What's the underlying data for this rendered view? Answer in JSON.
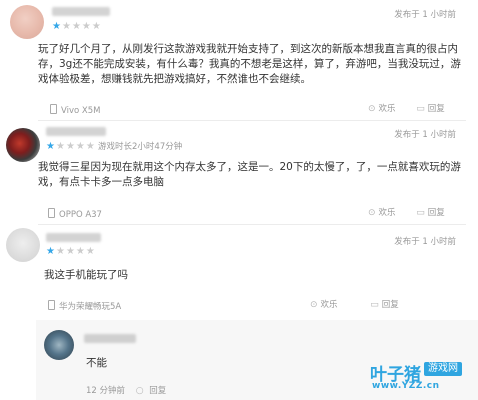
{
  "comments": [
    {
      "rating": 1,
      "posted": "发布于 1 小时前",
      "body": "玩了好几个月了，从刚发行这款游戏我就开始支持了，到这次的新版本想我直言真的很占内存，3g还不能完成安装，有什么毒？我真的不想老是这样，算了，弃游吧，当我没玩过，游戏体验极差，想赚钱就先把游戏搞好，不然谁也不会继续。",
      "device": "Vivo X5M",
      "actions": {
        "like": "欢乐",
        "reply": "回复"
      }
    },
    {
      "rating": 1,
      "playtime": "游戏时长2小时47分钟",
      "posted": "发布于 1 小时前",
      "body": "我觉得三星因为现在就用这个内存太多了，这是一。20下的太慢了，了，一点就喜欢玩的游戏，有点卡卡多一点多电脑",
      "device": "OPPO A37",
      "actions": {
        "like": "欢乐",
        "reply": "回复"
      }
    },
    {
      "rating": 1,
      "posted": "发布于 1 小时前",
      "body": "我这手机能玩了吗",
      "device": "华为荣耀畅玩5A",
      "actions": {
        "like": "欢乐",
        "reply": "回复"
      }
    }
  ],
  "reply": {
    "body": "不能",
    "posted": "12 分钟前",
    "action": "回复"
  },
  "watermark": {
    "brand": "叶子猪",
    "badge": "游戏网",
    "url": "www.YZZ.cn"
  },
  "colors": {
    "accent": "#35a7e8",
    "watermark": "#2fa5e0"
  },
  "icons": [
    "star-icon",
    "phone-icon",
    "comment-icon",
    "like-icon",
    "reply-icon"
  ]
}
